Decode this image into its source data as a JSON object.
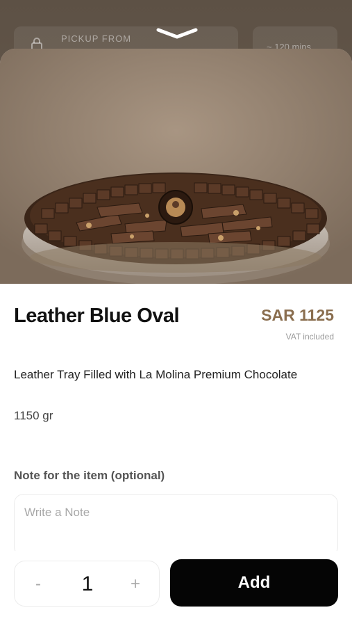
{
  "background": {
    "pickup_label": "PICKUP FROM",
    "time_label": "~ 120 mins"
  },
  "product": {
    "name": "Leather Blue Oval",
    "price": "SAR 1125",
    "vat_note": "VAT included",
    "description": "Leather Tray Filled with La Molina Premium Chocolate",
    "weight": "1150 gr",
    "image_icon": "chocolate-tray-photo"
  },
  "note": {
    "label": "Note for the item (optional)",
    "placeholder": "Write a Note",
    "value": ""
  },
  "cart": {
    "minus_label": "-",
    "quantity": "1",
    "plus_label": "+",
    "add_label": "Add"
  },
  "colors": {
    "price": "#8a6e4f",
    "add_button": "#050505"
  }
}
